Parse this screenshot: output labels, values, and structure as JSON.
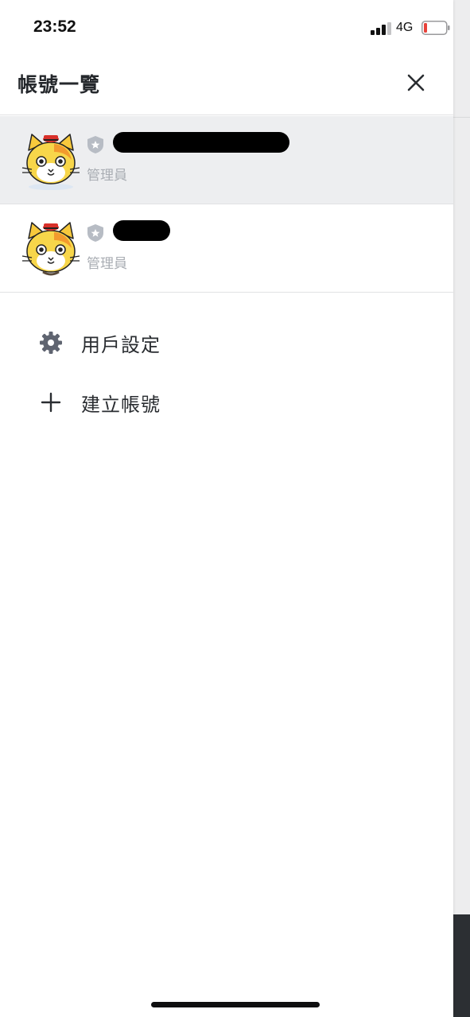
{
  "status_bar": {
    "time": "23:52",
    "network": "4G",
    "battery_level": 0.12,
    "battery_color": "#e8423a"
  },
  "header": {
    "title": "帳號一覽",
    "close_icon": "close-icon"
  },
  "accounts": [
    {
      "role": "管理員",
      "selected": true,
      "avatar_icon": "cat-avatar-icon",
      "badge_icon": "admin-shield-icon"
    },
    {
      "role": "管理員",
      "selected": false,
      "avatar_icon": "cat-avatar-icon",
      "badge_icon": "admin-shield-icon"
    }
  ],
  "menu": [
    {
      "label": "用戶設定",
      "icon": "gear-icon"
    },
    {
      "label": "建立帳號",
      "icon": "plus-icon"
    }
  ],
  "colors": {
    "selected_row": "#edeef0",
    "divider": "#e1e2e4",
    "secondary_text": "#a9adb3",
    "icon_gray": "#5f6470"
  }
}
